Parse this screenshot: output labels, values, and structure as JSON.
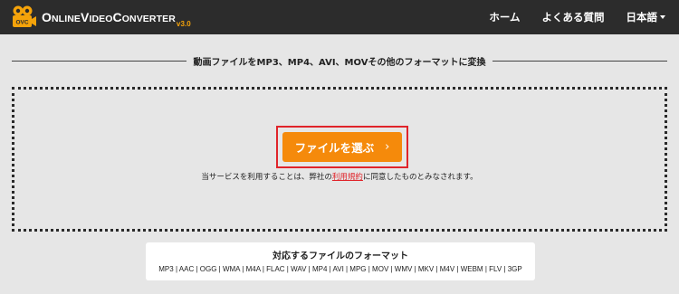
{
  "header": {
    "logo": {
      "badge": "OVC",
      "text_prefix": "O",
      "text_line": "NLINE",
      "text_v": "V",
      "text_ideo": "IDEO",
      "text_c": "C",
      "text_onverter": "ONVERTER",
      "version": "v3.0"
    },
    "nav": {
      "home": "ホーム",
      "faq": "よくある質問",
      "language": "日本語"
    },
    "colors": {
      "bar": "#2c2c2c",
      "accent": "#f5a30a"
    }
  },
  "main": {
    "divider_text": "動画ファイルをMP3、MP4、AVI、MOVその他のフォーマットに変換",
    "choose_button": "ファイルを選ぶ",
    "choose_chevron": "›",
    "terms_before": "当サービスを利用することは、弊社の",
    "terms_link": "利用規約",
    "terms_after": "に同意したものとみなされます。",
    "colors": {
      "button": "#f58a0b",
      "highlight": "#e0242a"
    }
  },
  "formats": {
    "title": "対応するファイルのフォーマット",
    "list": "MP3 | AAC | OGG | WMA | M4A | FLAC | WAV | MP4 | AVI | MPG | MOV | WMV | MKV | M4V | WEBM | FLV | 3GP"
  }
}
